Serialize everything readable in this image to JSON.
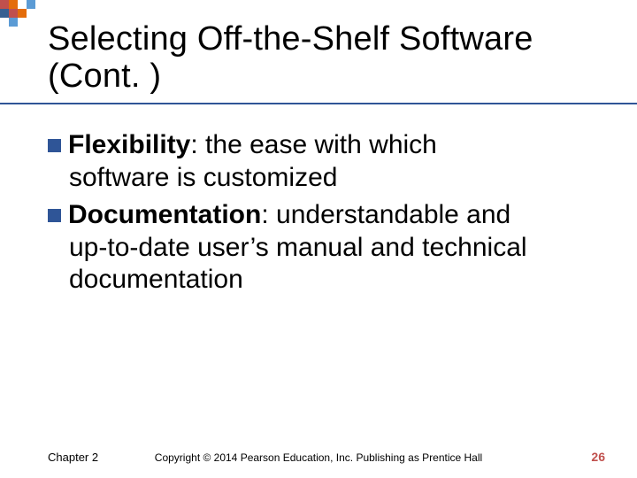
{
  "title": "Selecting Off-the-Shelf Software (Cont. )",
  "items": [
    {
      "term": "Flexibility",
      "desc_first": ": the ease with which",
      "desc_rest": "software is customized"
    },
    {
      "term": "Documentation",
      "desc_first": ": understandable and",
      "desc_rest": "up-to-date user’s manual and technical documentation"
    }
  ],
  "footer": {
    "left": "Chapter 2",
    "center": "Copyright © 2014 Pearson Education, Inc. Publishing as Prentice Hall",
    "right": "26"
  }
}
